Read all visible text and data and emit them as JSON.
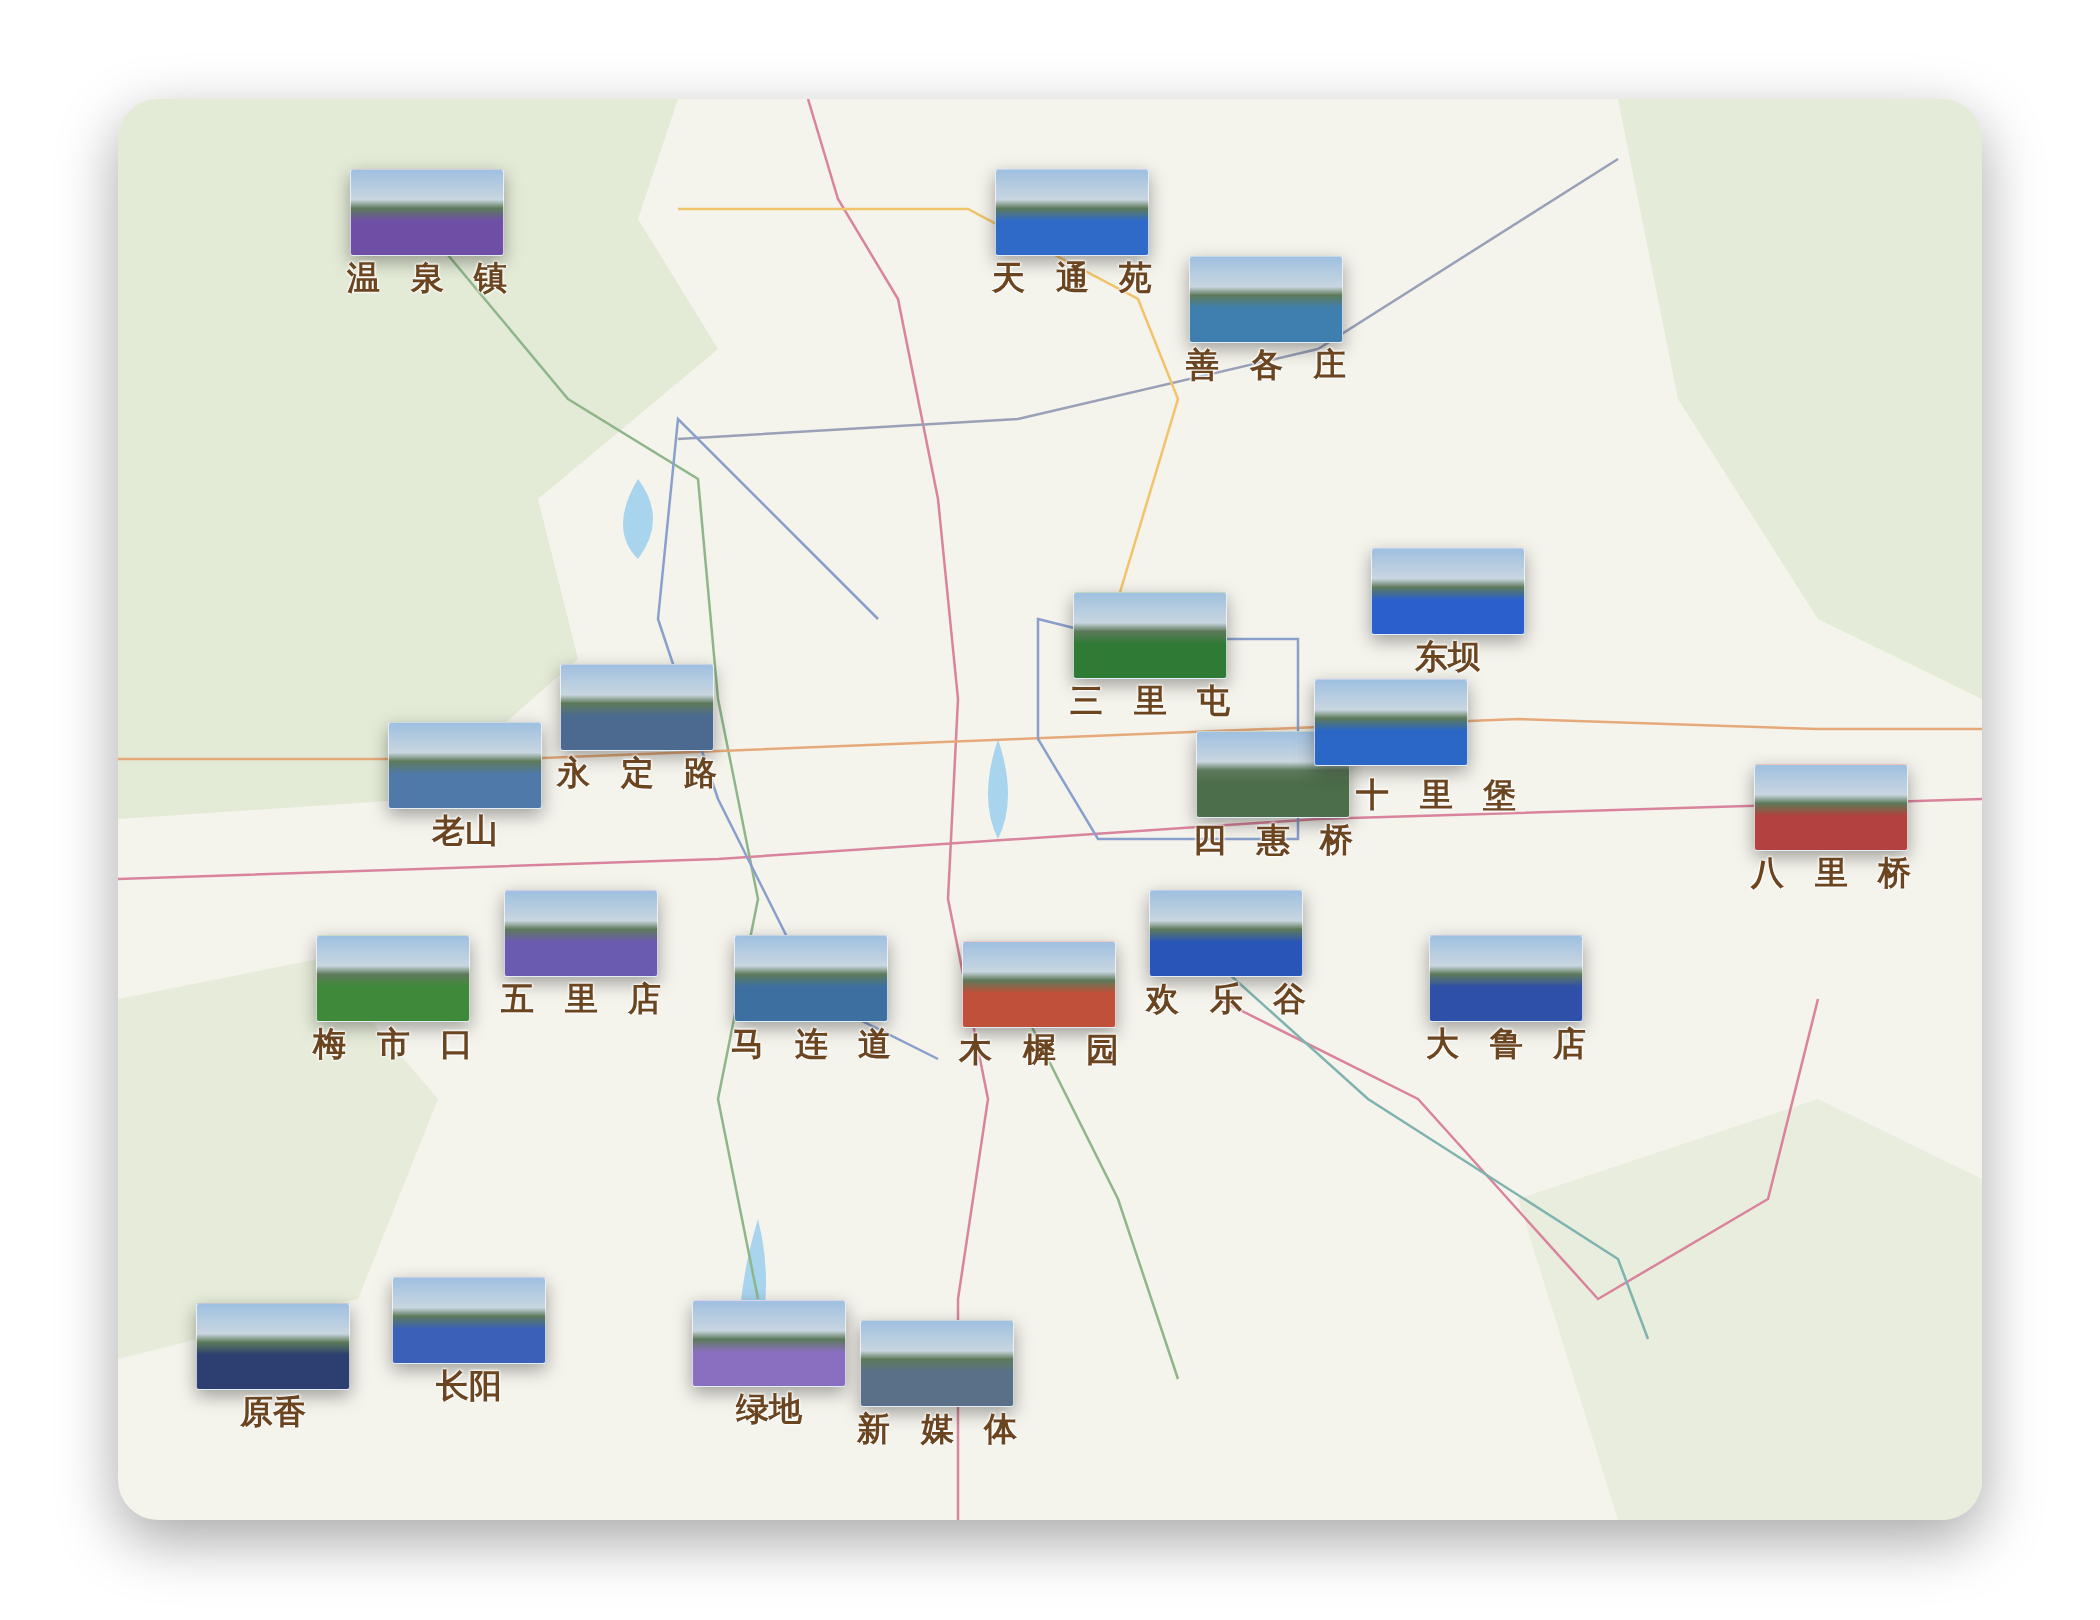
{
  "map": {
    "pins": [
      {
        "label": "温泉镇"
      },
      {
        "label": "天通苑"
      },
      {
        "label": "善各庄"
      },
      {
        "label": "东坝"
      },
      {
        "label": "三里屯"
      },
      {
        "label": "四惠桥"
      },
      {
        "label": "十里堡"
      },
      {
        "label": "永定路"
      },
      {
        "label": "老山"
      },
      {
        "label": "八里桥"
      },
      {
        "label": "五里店"
      },
      {
        "label": "欢乐谷"
      },
      {
        "label": "梅市口"
      },
      {
        "label": "马连道"
      },
      {
        "label": "木樨园"
      },
      {
        "label": "大鲁店"
      },
      {
        "label": "原香"
      },
      {
        "label": "长阳"
      },
      {
        "label": "绿地"
      },
      {
        "label": "新媒体"
      }
    ]
  }
}
